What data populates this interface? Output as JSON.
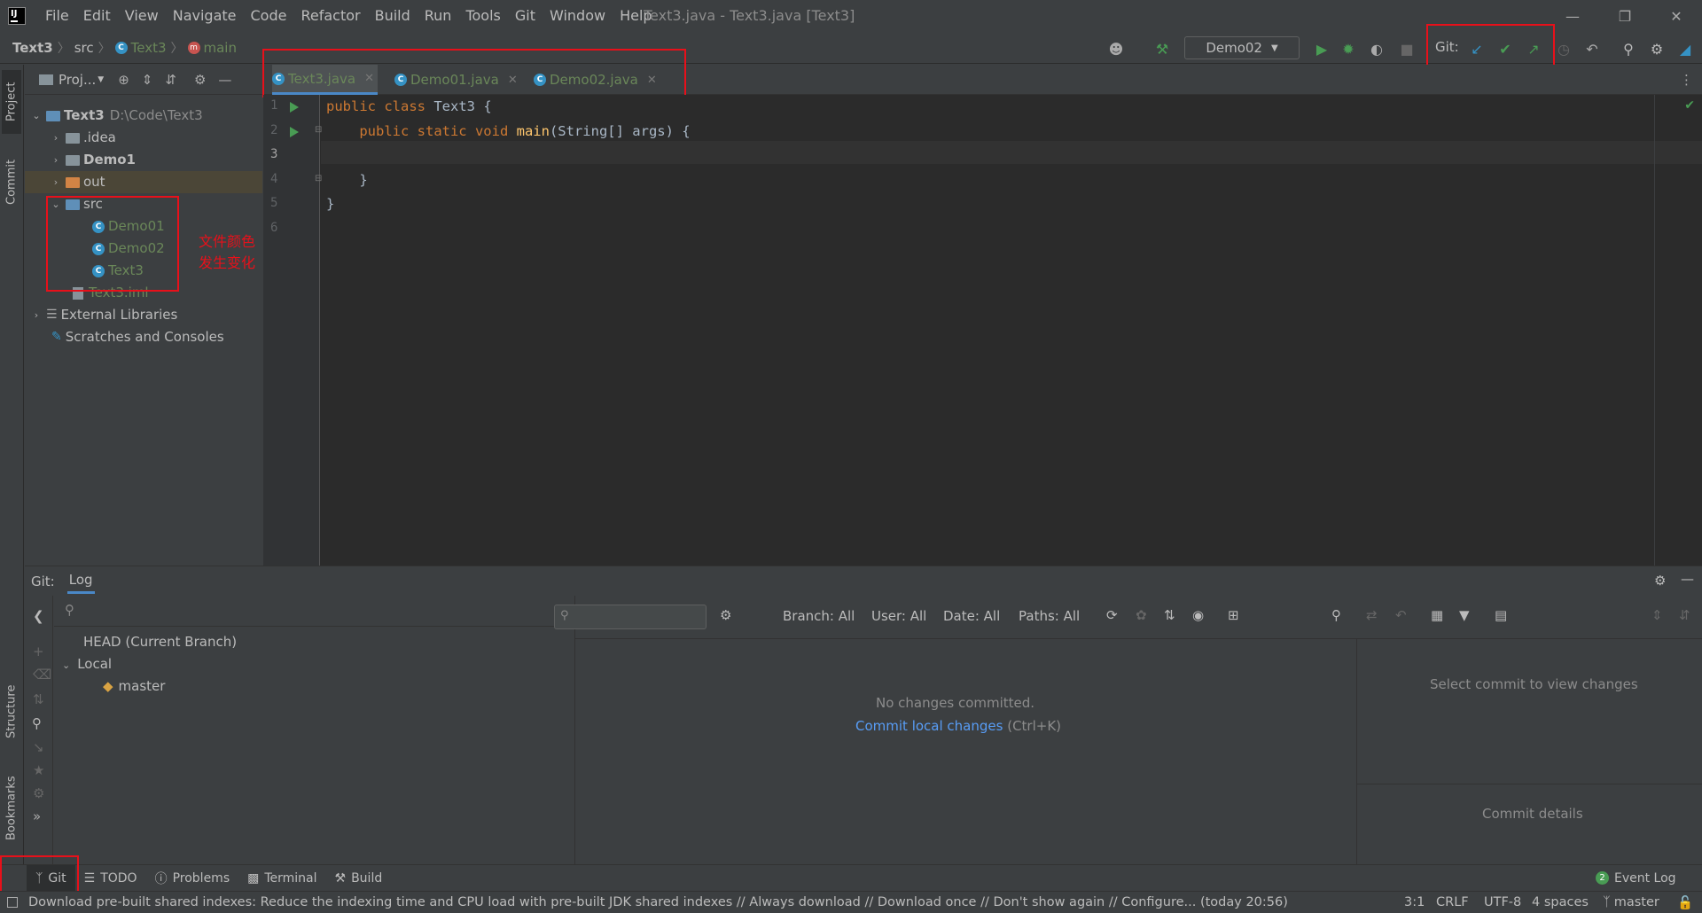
{
  "menu": {
    "items": [
      "File",
      "Edit",
      "View",
      "Navigate",
      "Code",
      "Refactor",
      "Build",
      "Run",
      "Tools",
      "Git",
      "Window",
      "Help"
    ],
    "window_title": "Text3.java - Text3.java [Text3]"
  },
  "navbar": {
    "project": "Text3",
    "folder": "src",
    "class": "Text3",
    "method": "main",
    "run_config": "Demo02",
    "git_label": "Git:"
  },
  "side_tabs": {
    "project": "Project",
    "commit": "Commit",
    "structure": "Structure",
    "bookmarks": "Bookmarks"
  },
  "project_panel": {
    "title": "Proj...",
    "root": {
      "name": "Text3",
      "path": "D:\\Code\\Text3"
    },
    "items": [
      {
        "label": ".idea"
      },
      {
        "label": "Demo1"
      },
      {
        "label": "out"
      },
      {
        "label": "src"
      },
      {
        "label": "Demo01"
      },
      {
        "label": "Demo02"
      },
      {
        "label": "Text3"
      },
      {
        "label": "Text3.iml"
      },
      {
        "label": "External Libraries"
      },
      {
        "label": "Scratches and Consoles"
      }
    ],
    "annotation": "文件颜色发生变化"
  },
  "editor": {
    "tabs": [
      {
        "label": "Text3.java"
      },
      {
        "label": "Demo01.java"
      },
      {
        "label": "Demo02.java"
      }
    ],
    "line_numbers": [
      "1",
      "2",
      "3",
      "4",
      "5",
      "6"
    ],
    "lines": [
      "public class Text3 {",
      "    public static void main(String[] args) {",
      "",
      "    }",
      "}"
    ]
  },
  "git_panel": {
    "title": "Git:",
    "tab": "Log",
    "branches": {
      "head": "HEAD (Current Branch)",
      "local": "Local",
      "master": "master"
    },
    "filters": {
      "branch": "Branch: All",
      "user": "User: All",
      "date": "Date: All",
      "paths": "Paths: All"
    },
    "empty_msg": "No changes committed.",
    "commit_link": "Commit local changes",
    "commit_shortcut": "(Ctrl+K)",
    "select_msg": "Select commit to view changes",
    "details": "Commit details"
  },
  "bottom_tabs": {
    "git": "Git",
    "todo": "TODO",
    "problems": "Problems",
    "terminal": "Terminal",
    "build": "Build",
    "event_log": "Event Log",
    "event_count": "2"
  },
  "status": {
    "message": "Download pre-built shared indexes: Reduce the indexing time and CPU load with pre-built JDK shared indexes // Always download // Download once // Don't show again // Configure... (today 20:56)",
    "position": "3:1",
    "line_sep": "CRLF",
    "encoding": "UTF-8",
    "indent": "4 spaces",
    "branch": "master"
  },
  "colors": {
    "accent_green": "#6a8759",
    "annotation_red": "#e8101a",
    "link_blue": "#589df6"
  }
}
